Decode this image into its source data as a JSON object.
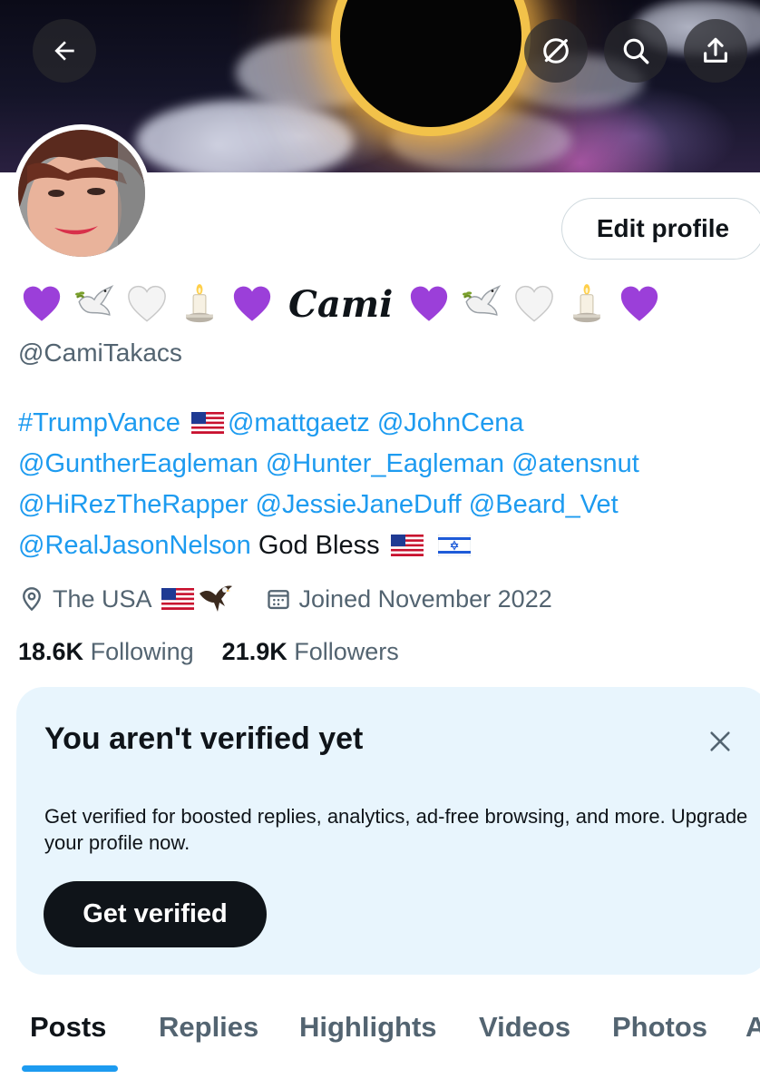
{
  "header": {
    "back_icon": "arrow-left-icon",
    "grok_icon": "grok-icon",
    "search_icon": "search-icon",
    "share_icon": "share-icon"
  },
  "profile": {
    "display_name": "Cami",
    "name_emojis_left": [
      "purple-heart",
      "dove",
      "white-heart",
      "candle",
      "purple-heart"
    ],
    "name_emojis_right": [
      "purple-heart",
      "dove",
      "white-heart",
      "candle",
      "purple-heart"
    ],
    "handle": "@CamiTakacs",
    "edit_label": "Edit profile",
    "bio": {
      "l1_a": "#TrumpVance",
      "l1_b": "@mattgaetz @JohnCena",
      "l2": "@GuntherEagleman @Hunter_Eagleman @atensnut",
      "l3": "@HiRezTheRapper @JessieJaneDuff @Beard_Vet",
      "l4_link": "@RealJasonNelson",
      "l4_text": "God Bless"
    },
    "location": "The USA",
    "joined": "Joined November 2022",
    "following_count": "18.6K",
    "following_label": "Following",
    "followers_count": "21.9K",
    "followers_label": "Followers"
  },
  "verify_card": {
    "title": "You aren't verified yet",
    "body": "Get verified for boosted replies, analytics, ad-free browsing, and more. Upgrade your profile now.",
    "button": "Get verified"
  },
  "tabs": [
    {
      "label": "Posts",
      "active": true
    },
    {
      "label": "Replies"
    },
    {
      "label": "Highlights"
    },
    {
      "label": "Videos"
    },
    {
      "label": "Photos"
    },
    {
      "label": "A"
    }
  ],
  "colors": {
    "accent": "#1d9bf0",
    "text_primary": "#0f1419",
    "text_secondary": "#536471",
    "card_bg": "#e8f5fd",
    "purple_heart": "#9b3fd9"
  }
}
